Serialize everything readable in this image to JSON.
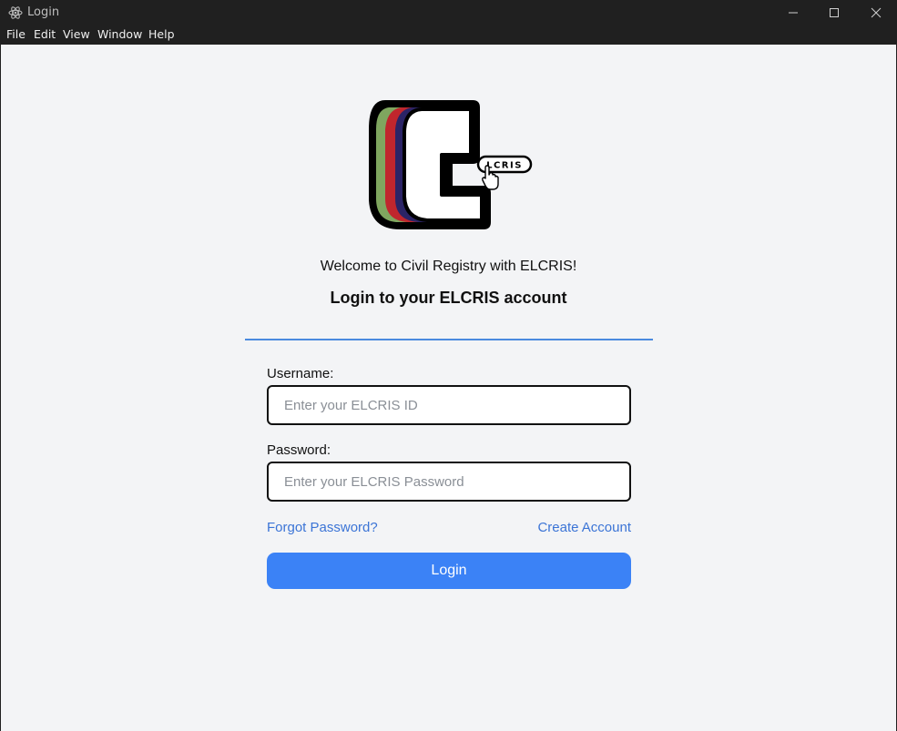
{
  "window": {
    "title": "Login",
    "app_icon": "electron-icon",
    "controls": {
      "minimize": "minimize-icon",
      "maximize": "maximize-icon",
      "close": "close-icon"
    }
  },
  "menu": {
    "items": [
      "File",
      "Edit",
      "View",
      "Window",
      "Help"
    ]
  },
  "logo": {
    "text": "LCRIS",
    "colors": [
      "#7fa65f",
      "#c0262d",
      "#2b2466"
    ]
  },
  "main": {
    "welcome": "Welcome to Civil Registry with ELCRIS!",
    "heading": "Login to your ELCRIS account"
  },
  "form": {
    "username_label": "Username:",
    "username_placeholder": "Enter your ELCRIS ID",
    "username_value": "",
    "password_label": "Password:",
    "password_placeholder": "Enter your ELCRIS Password",
    "password_value": "",
    "forgot_password": "Forgot Password?",
    "create_account": "Create Account",
    "login_button": "Login"
  },
  "colors": {
    "accent": "#3b82f6",
    "link": "#3b74d6",
    "divider": "#4a8adf",
    "background": "#f3f4f6"
  }
}
